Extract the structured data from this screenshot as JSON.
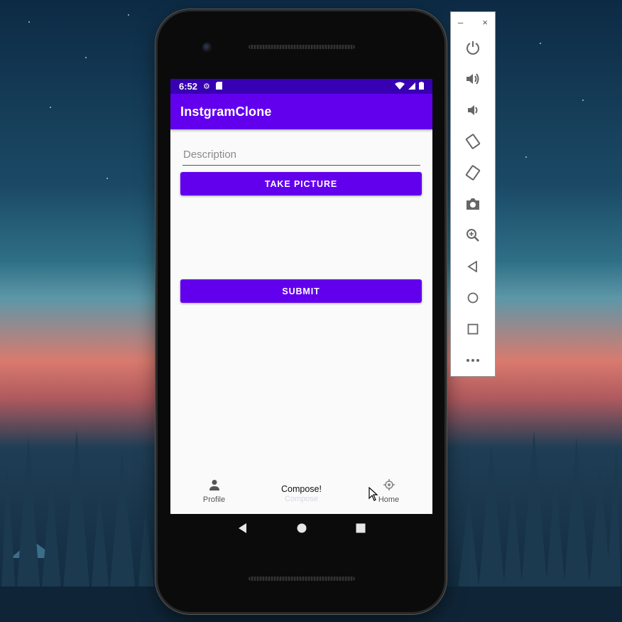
{
  "status_bar": {
    "time": "6:52"
  },
  "app_bar": {
    "title": "InstgramClone"
  },
  "form": {
    "description_placeholder": "Description",
    "description_value": "",
    "take_picture_label": "TAKE PICTURE",
    "submit_label": "SUBMIT"
  },
  "bottom_nav": {
    "profile_label": "Profile",
    "compose_title": "Compose!",
    "compose_label": "Compose",
    "home_label": "Home"
  },
  "emulator_panel": {
    "minimize": "–",
    "close": "×",
    "buttons": [
      "power-icon",
      "volume-up-icon",
      "volume-down-icon",
      "rotate-left-icon",
      "rotate-right-icon",
      "camera-icon",
      "zoom-icon",
      "back-icon",
      "home-icon",
      "overview-icon",
      "more-icon"
    ]
  },
  "colors": {
    "status_bar": "#3700b3",
    "primary": "#6200ee",
    "screen_bg": "#fafafa"
  }
}
